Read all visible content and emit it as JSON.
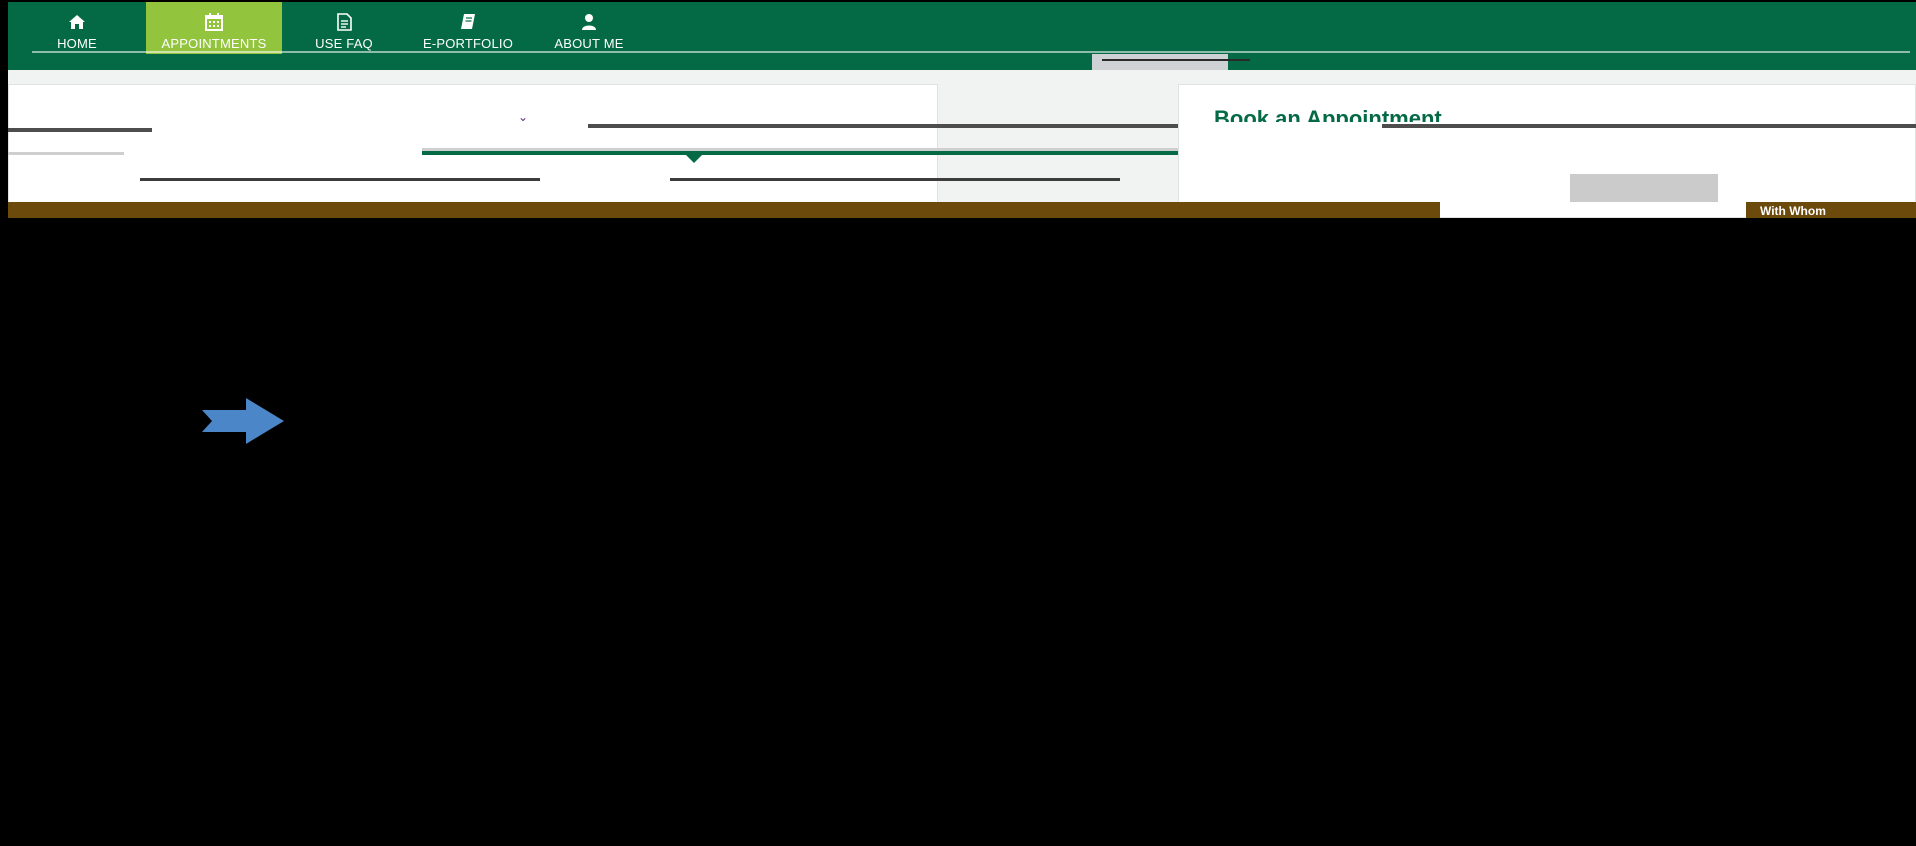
{
  "nav": {
    "items": [
      {
        "label": "HOME",
        "icon": "home-icon"
      },
      {
        "label": "APPOINTMENTS",
        "icon": "calendar-icon"
      },
      {
        "label": "USE FAQ",
        "icon": "document-icon"
      },
      {
        "label": "E-PORTFOLIO",
        "icon": "book-icon"
      },
      {
        "label": "ABOUT ME",
        "icon": "user-icon"
      }
    ]
  },
  "panel": {
    "right_title": "Book an Appointment",
    "brown_card_label": "With Whom"
  },
  "colors": {
    "nav_green": "#046a46",
    "active_green": "#92c43e",
    "brown": "#6b4a0b",
    "arrow_blue": "#4a86c8"
  }
}
